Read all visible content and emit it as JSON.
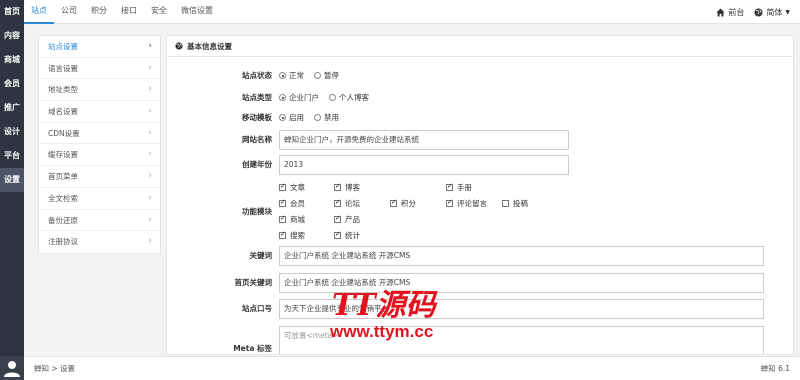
{
  "leftnav": {
    "items": [
      "首页",
      "内容",
      "商城",
      "会员",
      "推广",
      "设计",
      "平台",
      "设置"
    ],
    "active_index": 7
  },
  "topbar": {
    "tabs": [
      "站点",
      "公司",
      "积分",
      "接口",
      "安全",
      "微信设置"
    ],
    "active_index": 0,
    "front_label": "前台",
    "lang_label": "简体"
  },
  "submenu": {
    "items": [
      "站点设置",
      "语言设置",
      "地址类型",
      "域名设置",
      "CDN设置",
      "缓存设置",
      "首页菜单",
      "全文检索",
      "备份还原",
      "注册协议"
    ],
    "active_index": 0
  },
  "panel": {
    "title": "基本信息设置",
    "status": {
      "label": "站点状态",
      "options": [
        "正常",
        "暂停"
      ],
      "selected": 0
    },
    "type": {
      "label": "站点类型",
      "options": [
        "企业门户",
        "个人博客"
      ],
      "selected": 0
    },
    "mobile": {
      "label": "移动模板",
      "options": [
        "启用",
        "禁用"
      ],
      "selected": 0
    },
    "site_name": {
      "label": "网站名称",
      "value": "蝉知企业门户，开源免费的企业建站系统"
    },
    "year": {
      "label": "创建年份",
      "value": "2013"
    },
    "modules": {
      "label": "功能模块",
      "items": [
        {
          "name": "文章",
          "checked": true
        },
        {
          "name": "博客",
          "checked": true
        },
        {
          "name": "手册",
          "checked": true
        },
        {
          "name": "会员",
          "checked": true
        },
        {
          "name": "论坛",
          "checked": true
        },
        {
          "name": "积分",
          "checked": true
        },
        {
          "name": "评论留言",
          "checked": true
        },
        {
          "name": "投稿",
          "checked": false
        },
        {
          "name": "商城",
          "checked": true
        },
        {
          "name": "产品",
          "checked": true
        },
        {
          "name": "搜索",
          "checked": true
        },
        {
          "name": "统计",
          "checked": true
        }
      ]
    },
    "keywords": {
      "label": "关键词",
      "value": "企业门户系统 企业建站系统 开源CMS"
    },
    "index_keywords": {
      "label": "首页关键词",
      "value": "企业门户系统 企业建站系统 开源CMS"
    },
    "slogan": {
      "label": "站点口号",
      "value": "为天下企业提供专业的营销平台"
    },
    "meta": {
      "label": "Meta 标签",
      "placeholder": "可放置<meta>"
    }
  },
  "watermark": {
    "line1": "TT源码",
    "line2": "www.ttym.cc"
  },
  "footer": {
    "breadcrumb": "蝉知 > 设置",
    "version": "蝉知 6.1"
  },
  "colors": {
    "accent": "#2b8ad4",
    "leftnav_bg": "#303440",
    "watermark": "#e3121f"
  }
}
